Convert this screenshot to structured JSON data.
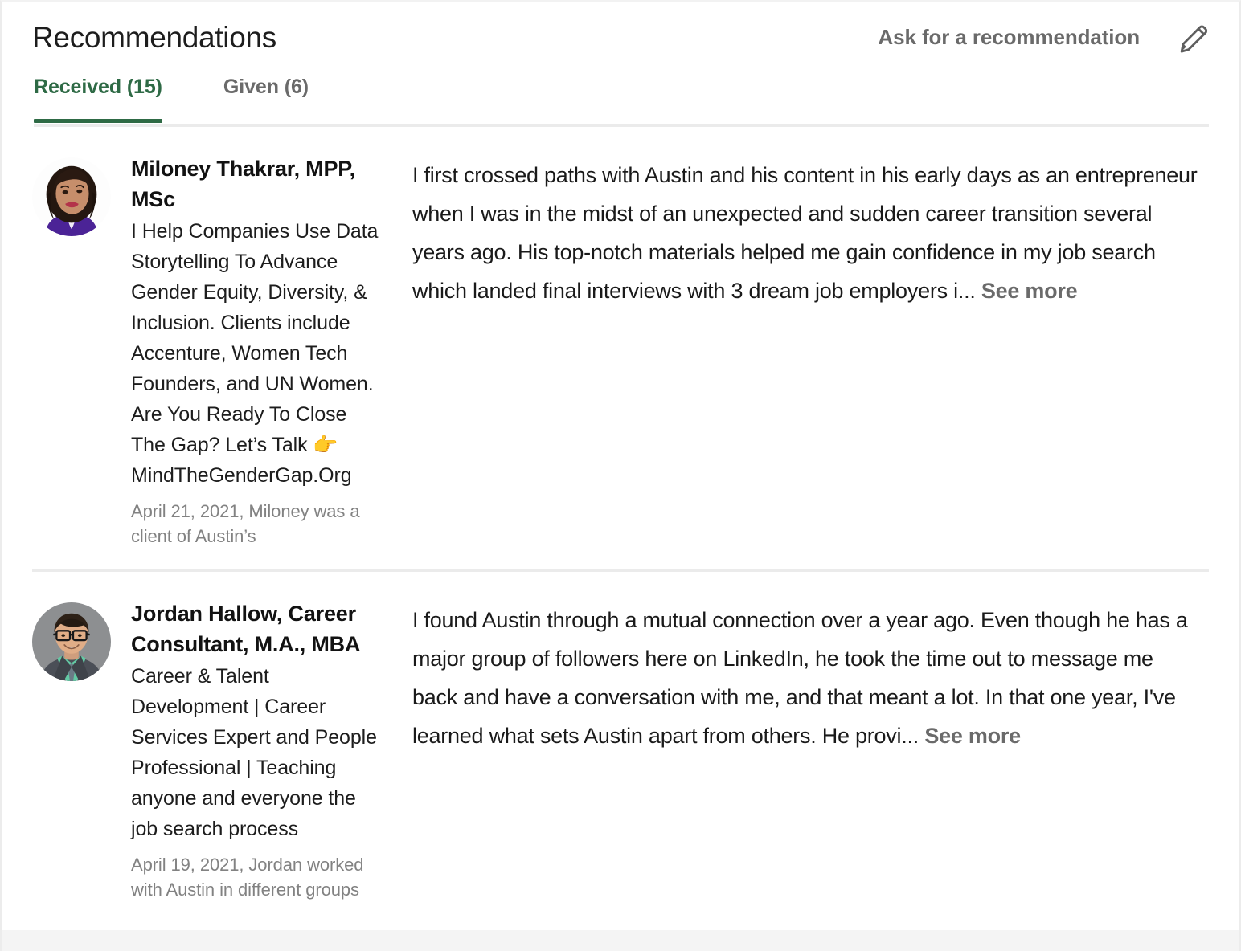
{
  "header": {
    "title": "Recommendations",
    "ask_label": "Ask for a recommendation",
    "edit_icon": "pencil-icon"
  },
  "tabs": [
    {
      "label": "Received (15)",
      "active": true
    },
    {
      "label": "Given (6)",
      "active": false
    }
  ],
  "colors": {
    "accent_green": "#2e6a45",
    "muted_gray": "#6a6a6a",
    "date_gray": "#828282",
    "divider": "#ebebeb",
    "text": "#1a1a1a"
  },
  "see_more_label": "See more",
  "recommendations": [
    {
      "name": "Miloney Thakrar, MPP, MSc",
      "headline": "I Help Companies Use Data Storytelling To Advance Gender Equity, Diversity, & Inclusion. Clients include Accenture, Women Tech Founders, and UN Women. Are You Ready To Close The Gap? Let’s Talk 👉 MindTheGenderGap.Org",
      "date": "April 21, 2021, Miloney was a client of Austin’s",
      "text": "I first crossed paths with Austin and his content in his early days as an entrepreneur when I was in the midst of an unexpected and sudden career transition several years ago. His top-notch materials helped me gain confidence in my job search which landed final interviews with 3 dream job employers i...",
      "avatar": "photo-woman-purple-top"
    },
    {
      "name": "Jordan Hallow, Career Consultant, M.A., MBA",
      "headline": "Career & Talent Development | Career Services Expert and People Professional | Teaching anyone and everyone the job search process",
      "date": "April 19, 2021, Jordan worked with Austin in different groups",
      "text": "I found Austin through a mutual connection over a year ago. Even though he has a major group of followers here on LinkedIn, he took the time out to message me back and have a conversation with me, and that meant a lot. In that one year, I've learned what sets Austin apart from others. He provi...",
      "avatar": "photo-man-glasses-gray-background"
    }
  ]
}
